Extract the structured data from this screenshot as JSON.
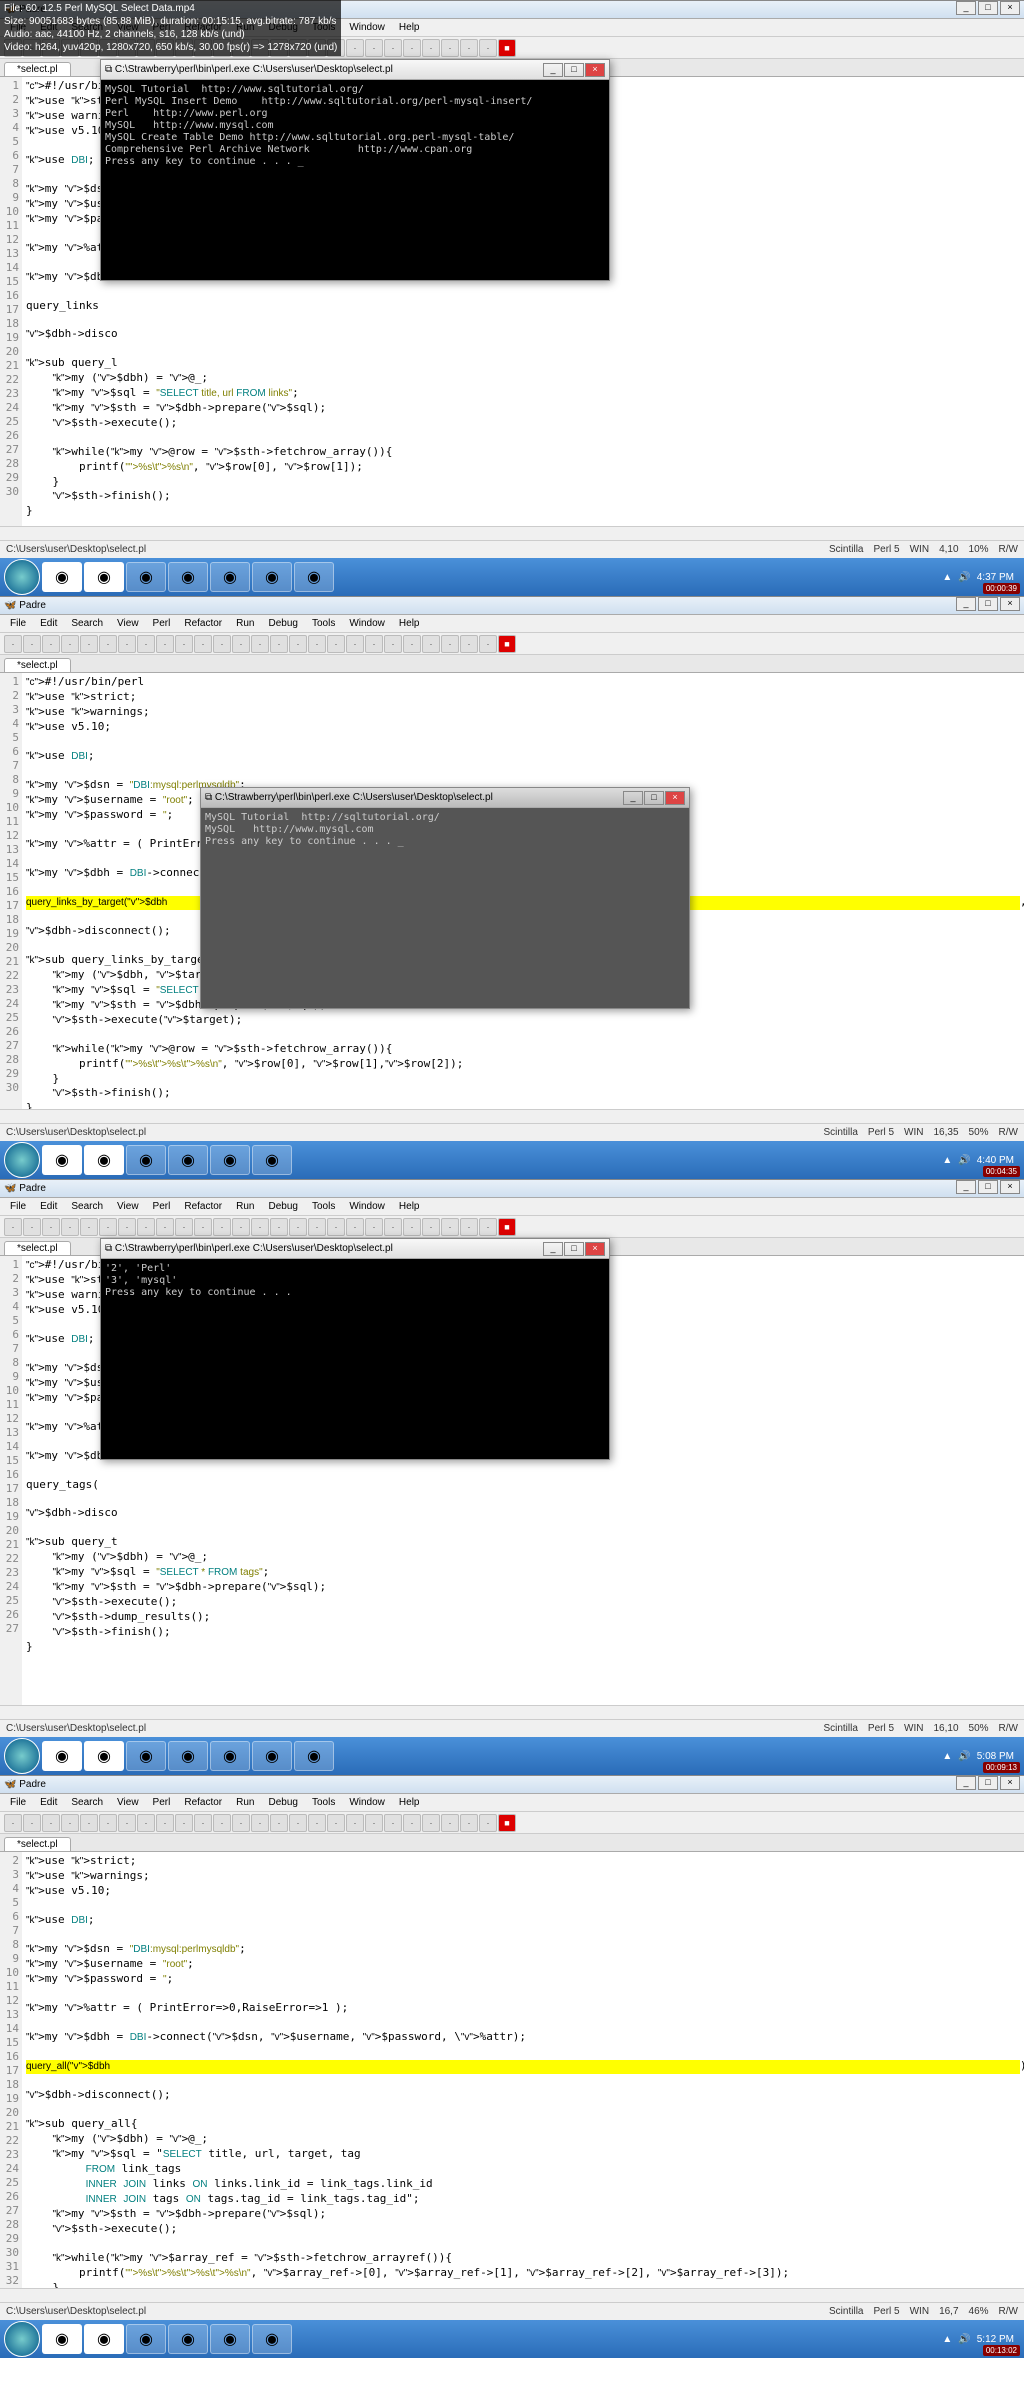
{
  "overlay": {
    "line1": "File: 60. 12.5 Perl MySQL Select Data.mp4",
    "line2": "Size: 90051683 bytes (85.88 MiB), duration: 00:15:15, avg.bitrate: 787 kb/s",
    "line3": "Audio: aac, 44100 Hz, 2 channels, s16, 128 kb/s (und)",
    "line4": "Video: h264, yuv420p, 1280x720, 650 kb/s, 30.00 fps(r) => 1278x720 (und)"
  },
  "app": {
    "title": "Padre",
    "menus": [
      "File",
      "Edit",
      "Search",
      "View",
      "Perl",
      "Refactor",
      "Run",
      "Debug",
      "Tools",
      "Window",
      "Help"
    ],
    "tab": "*select.pl",
    "path": "C:\\Users\\user\\Desktop\\select.pl"
  },
  "status": {
    "f1": {
      "scintilla": "Scintilla",
      "lang": "Perl 5",
      "os": "WIN",
      "pos": "4,10",
      "pct": "10%",
      "rw": "R/W"
    },
    "f2": {
      "scintilla": "Scintilla",
      "lang": "Perl 5",
      "os": "WIN",
      "pos": "16,35",
      "pct": "50%",
      "rw": "R/W"
    },
    "f3": {
      "scintilla": "Scintilla",
      "lang": "Perl 5",
      "os": "WIN",
      "pos": "16,10",
      "pct": "50%",
      "rw": "R/W"
    },
    "f4": {
      "scintilla": "Scintilla",
      "lang": "Perl 5",
      "os": "WIN",
      "pos": "16,7",
      "pct": "46%",
      "rw": "R/W"
    }
  },
  "clock": {
    "f1": {
      "time": "4:37 PM",
      "date": "00:00:39"
    },
    "f2": {
      "time": "4:40 PM",
      "date": "00:04:35"
    },
    "f3": {
      "time": "5:08 PM",
      "date": "00:09:13"
    },
    "f4": {
      "time": "5:12 PM",
      "date": "00:13:02"
    }
  },
  "cmd": {
    "title": "C:\\Strawberry\\perl\\bin\\perl.exe  C:\\Users\\user\\Desktop\\select.pl",
    "f1_body": "MySQL Tutorial  http://www.sqltutorial.org/\nPerl MySQL Insert Demo    http://www.sqltutorial.org/perl-mysql-insert/\nPerl    http://www.perl.org\nMySQL   http://www.mysql.com\nMySQL Create Table Demo http://www.sqltutorial.org.perl-mysql-table/\nComprehensive Perl Archive Network        http://www.cpan.org\nPress any key to continue . . . _",
    "f2_body": "MySQL Tutorial  http://sqltutorial.org/\nMySQL   http://www.mysql.com\nPress any key to continue . . . _",
    "f3_body": "'2', 'Perl'\n'3', 'mysql'\nPress any key to continue . . ."
  },
  "code": {
    "f1_lines": [
      "#!/usr/bin/perl",
      "use strict;",
      "use warning",
      "use v5.10;",
      "",
      "use DBI;",
      "",
      "my $dsn = \"",
      "my $username",
      "my $password",
      "",
      "my %attr = ",
      "",
      "my $dbh = D",
      "",
      "query_links",
      "",
      "$dbh->disco",
      "",
      "sub query_l",
      "    my ($dbh) = @_;",
      "    my $sql = \"SELECT title, url FROM links\";",
      "    my $sth = $dbh->prepare($sql);",
      "    $sth->execute();",
      "",
      "    while(my @row = $sth->fetchrow_array()){",
      "        printf(\"%s\\t%s\\n\", $row[0], $row[1]);",
      "    }",
      "    $sth->finish();",
      "}"
    ],
    "f2_lines": [
      "#!/usr/bin/perl",
      "use strict;",
      "use warnings;",
      "use v5.10;",
      "",
      "use DBI;",
      "",
      "my $dsn = \"DBI:mysql:perlmysqldb\";",
      "my $username = \"root\";",
      "my $password = '';",
      "",
      "my %attr = ( PrintError=>0,RaiseError=>1 );",
      "",
      "my $dbh = DBI->connect($dsn, $username, $password, \\%attr);",
      "",
      "query_links_by_target($dbh,'_self');",
      "",
      "$dbh->disconnect();",
      "",
      "sub query_links_by_target{",
      "    my ($dbh, $target) = @_;",
      "    my $sql = \"SELECT title, url,target FROM links WHERE target = ?\";",
      "    my $sth = $dbh->prepare($sql);",
      "    $sth->execute($target);",
      "",
      "    while(my @row = $sth->fetchrow_array()){",
      "        printf(\"%s\\t%s\\t%s\\n\", $row[0], $row[1],$row[2]);",
      "    }",
      "    $sth->finish();",
      "}"
    ],
    "f3_lines": [
      "#!/usr/bin/perl",
      "use strict;",
      "use warning",
      "use v5.10;",
      "",
      "use DBI;",
      "",
      "my $dsn = \"",
      "my $username",
      "my $password",
      "",
      "my %attr = ",
      "",
      "my $dbh = D",
      "",
      "query_tags(",
      "",
      "$dbh->disco",
      "",
      "sub query_t",
      "    my ($dbh) = @_;",
      "    my $sql = \"SELECT * FROM tags\";",
      "    my $sth = $dbh->prepare($sql);",
      "    $sth->execute();",
      "    $sth->dump_results();",
      "    $sth->finish();",
      "}"
    ],
    "f4_lines": [
      "use strict;",
      "use warnings;",
      "use v5.10;",
      "",
      "use DBI;",
      "",
      "my $dsn = \"DBI:mysql:perlmysqldb\";",
      "my $username = \"root\";",
      "my $password = '';",
      "",
      "my %attr = ( PrintError=>0,RaiseError=>1 );",
      "",
      "my $dbh = DBI->connect($dsn, $username, $password, \\%attr);",
      "",
      "query_all($dbh);",
      "",
      "$dbh->disconnect();",
      "",
      "sub query_all{",
      "    my ($dbh) = @_;",
      "    my $sql = \"SELECT title, url, target, tag",
      "         FROM link_tags",
      "         INNER JOIN links ON links.link_id = link_tags.link_id",
      "         INNER JOIN tags ON tags.tag_id = link_tags.tag_id\";",
      "    my $sth = $dbh->prepare($sql);",
      "    $sth->execute();",
      "",
      "    while(my $array_ref = $sth->fetchrow_arrayref()){",
      "        printf(\"%s\\t%s\\t%s\\t%s\\n\", $array_ref->[0], $array_ref->[1], $array_ref->[2], $array_ref->[3]);",
      "    }",
      "    $sth->finish();",
      "}"
    ],
    "f2_hl": 15,
    "f4_hl": 14
  }
}
